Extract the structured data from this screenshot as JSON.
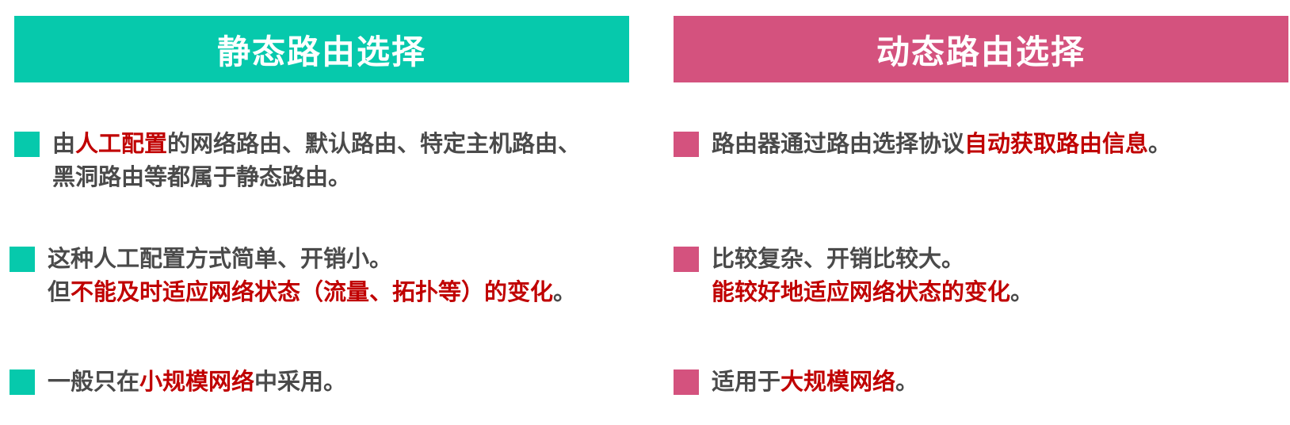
{
  "left": {
    "title": "静态路由选择",
    "colors": {
      "accent": "#06C9AC",
      "highlight": "#C00000"
    },
    "b1": {
      "p1": "由",
      "h1": "人工配置",
      "p2": "的网络路由、默认路由、特定主机路由、",
      "line2": "黑洞路由等都属于静态路由。"
    },
    "b2": {
      "line1": "这种人工配置方式简单、开销小。",
      "p1": "但",
      "h1": "不能及时适应网络状态（流量、拓扑等）的变化",
      "p2": "。"
    },
    "b3": {
      "p1": "一般只在",
      "h1": "小规模网络",
      "p2": "中采用。"
    }
  },
  "right": {
    "title": "动态路由选择",
    "colors": {
      "accent": "#D4527E",
      "highlight": "#C00000"
    },
    "b1": {
      "p1": "路由器通过路由选择协议",
      "h1": "自动获取路由信息",
      "p2": "。"
    },
    "b2": {
      "line1": "比较复杂、开销比较大。",
      "h1": "能较好地适应网络状态的变化",
      "p2": "。"
    },
    "b3": {
      "p1": "适用于",
      "h1": "大规模网络",
      "p2": "。"
    }
  }
}
